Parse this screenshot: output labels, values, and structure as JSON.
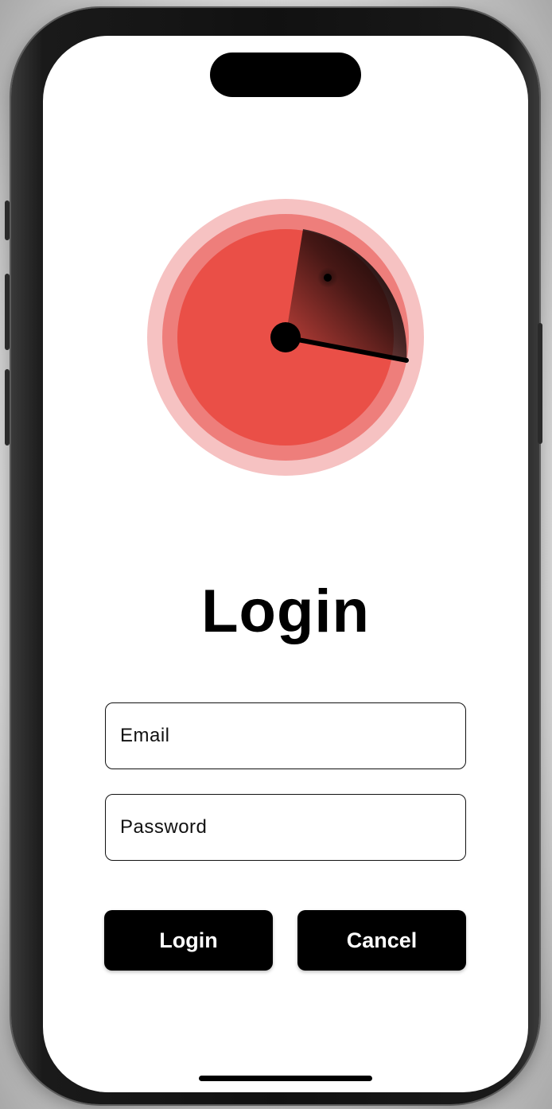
{
  "screen": {
    "title": "Login"
  },
  "form": {
    "email_placeholder": "Email",
    "password_placeholder": "Password"
  },
  "buttons": {
    "login_label": "Login",
    "cancel_label": "Cancel"
  },
  "logo": {
    "icon": "radar-icon",
    "colors": {
      "outer_ring": "#f6c2c2",
      "middle_ring": "#ee7e7b",
      "face": "#ea4f47",
      "sweep": "#000000",
      "hub": "#000000"
    }
  }
}
